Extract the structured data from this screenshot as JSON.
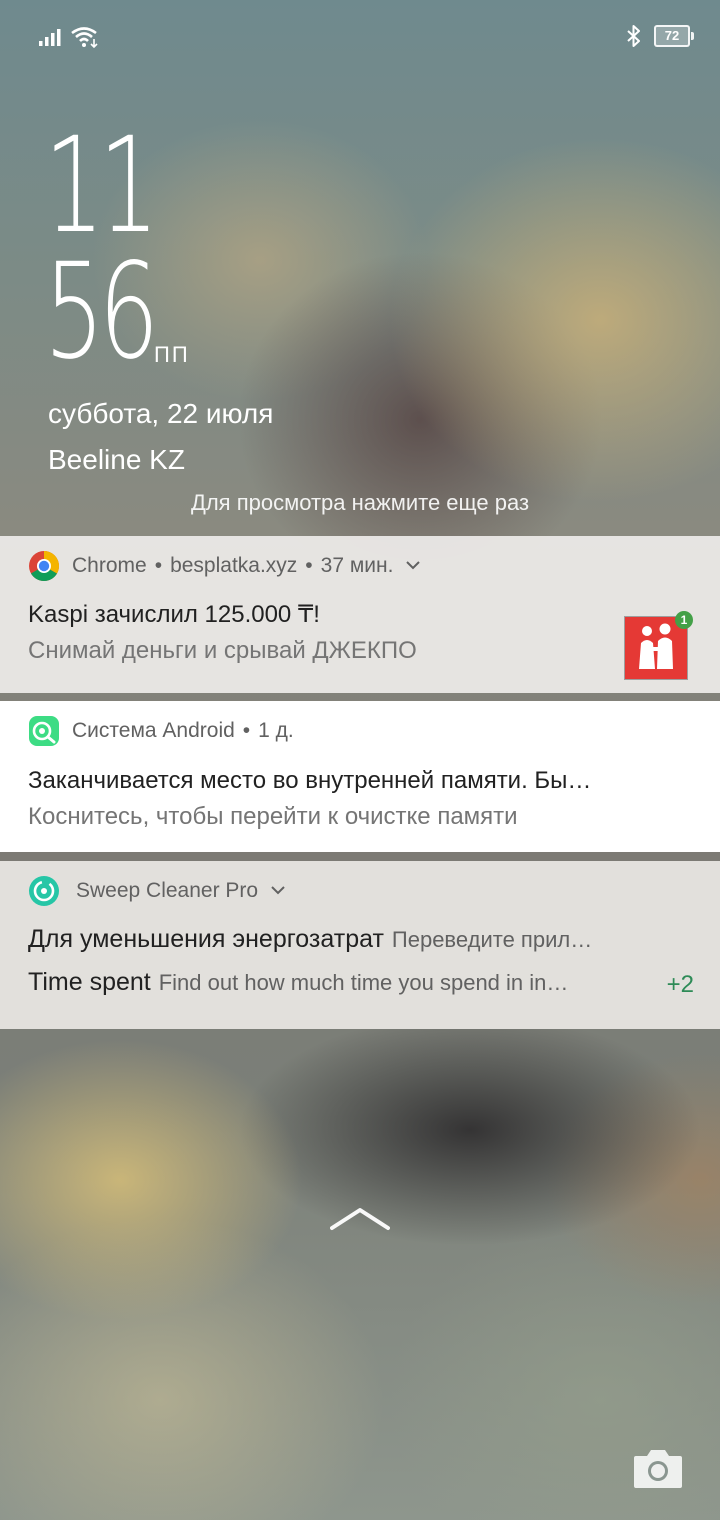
{
  "status_bar": {
    "icons": [
      "signal-icon",
      "wifi-icon",
      "bluetooth-icon",
      "battery-icon"
    ],
    "battery_level": "72"
  },
  "lockscreen": {
    "hours": "11",
    "minutes": "56",
    "ampm": "ПП",
    "date": "суббота, 22 июля",
    "carrier": "Beeline KZ",
    "hint": "Для просмотра нажмите еще раз"
  },
  "notifications": [
    {
      "app": "Chrome",
      "source": "besplatka.xyz",
      "time": "37 мин.",
      "title": "Kaspi зачислил 125.000 ₸!",
      "body": "Снимай деньги и срывай ДЖЕКПО",
      "badge": "1",
      "icon": "chrome-icon"
    },
    {
      "app": "Система Android",
      "time": "1 д.",
      "title": "Заканчивается место во внутренней памяти. Бы…",
      "body": "Коснитесь, чтобы перейти к очистке памяти",
      "icon": "android-system-icon"
    },
    {
      "app": "Sweep Cleaner Pro",
      "line1_title": "Для уменьшения энергозатрат",
      "line1_body": "Переведите прил…",
      "line2_title": "Time spent",
      "line2_body": "Find out how much time you spend in in…",
      "more_count": "+2",
      "icon": "sweep-cleaner-icon"
    }
  ],
  "colors": {
    "notification_text": "#212121",
    "notification_secondary": "#757575",
    "more_count": "#2e8b57",
    "kaspi_red": "#e53935"
  }
}
